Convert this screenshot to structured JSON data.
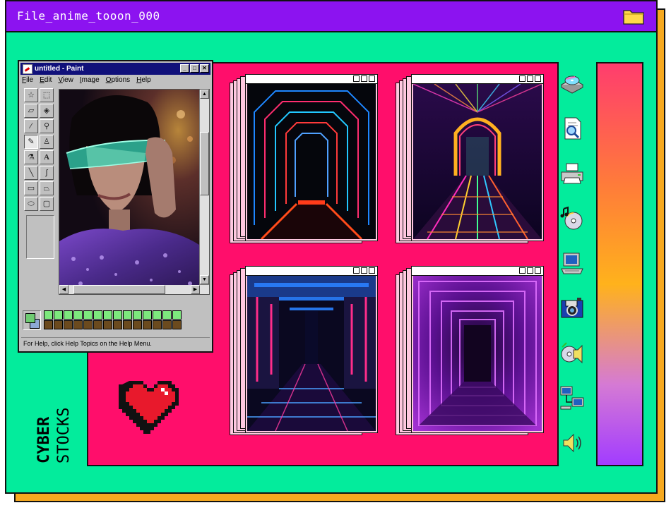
{
  "window": {
    "title": "File_anime_tooon_000",
    "folder_icon": "folder-icon"
  },
  "paint": {
    "title": "untitled - Paint",
    "menu": [
      "File",
      "Edit",
      "View",
      "Image",
      "Options",
      "Help"
    ],
    "status": "For Help, click Help Topics on the Help Menu.",
    "current_fg": "#6ecb72",
    "current_bg": "#8da9d6",
    "palette_top": [
      "#7de87d",
      "#7de87d",
      "#7de87d",
      "#7de87d",
      "#7de87d",
      "#7de87d",
      "#7de87d",
      "#7de87d",
      "#7de87d",
      "#7de87d",
      "#7de87d",
      "#7de87d",
      "#7de87d",
      "#7de87d"
    ],
    "palette_bottom": [
      "#6b4a1e",
      "#6b4a1e",
      "#6b4a1e",
      "#6b4a1e",
      "#6b4a1e",
      "#6b4a1e",
      "#6b4a1e",
      "#6b4a1e",
      "#6b4a1e",
      "#6b4a1e",
      "#6b4a1e",
      "#6b4a1e",
      "#6b4a1e",
      "#6b4a1e"
    ]
  },
  "gallery": [
    {
      "name": "neon-corridor-red-blue"
    },
    {
      "name": "neon-arch-rainbow"
    },
    {
      "name": "neon-hallway-blue-pink"
    },
    {
      "name": "neon-purple-tunnel"
    }
  ],
  "desktop_icons": [
    "cd-drive-icon",
    "document-search-icon",
    "printer-icon",
    "music-cd-icon",
    "computer-icon",
    "camera-floppy-icon",
    "cd-audio-icon",
    "network-icon",
    "speaker-icon"
  ],
  "brand": {
    "line1": "CYBER",
    "line2": "STOCKS"
  },
  "colors": {
    "frame": "#03ec9c",
    "titlebar": "#8c13f0",
    "panel": "#ff0e6b",
    "shadow": "#f6a91f",
    "heart": "#e8192c"
  }
}
